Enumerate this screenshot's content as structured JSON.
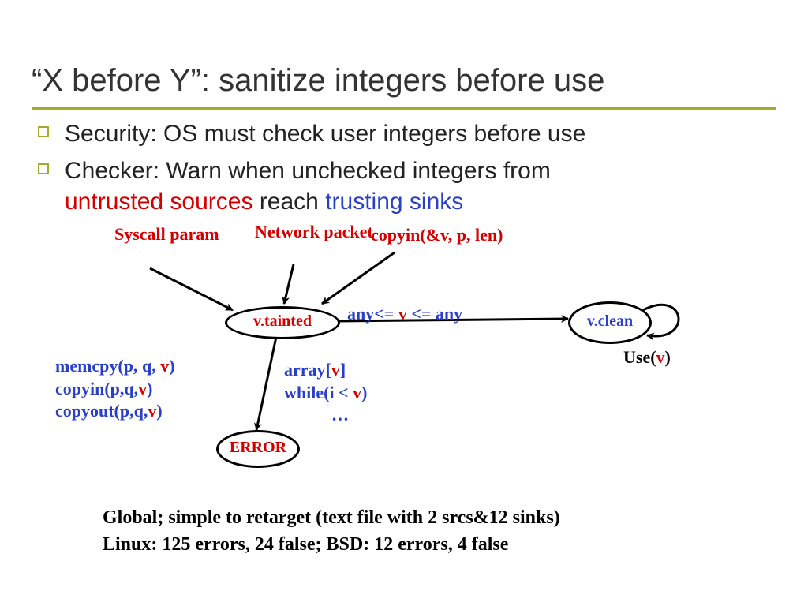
{
  "title": "“X before Y”: sanitize integers before use",
  "bullets": {
    "b1": "Security: OS must check user integers before use",
    "b2_pre": "Checker:  Warn when unchecked integers from ",
    "b2_red": "untrusted sources",
    "b2_mid": " reach ",
    "b2_blue": "trusting sinks"
  },
  "diagram": {
    "syscall": "Syscall param",
    "network": "Network packet",
    "copyin_top": "copyin(&v, p, len)",
    "tainted": "v.tainted",
    "clean": "v.clean",
    "any_left": "any<= ",
    "any_v": "v",
    "any_right": " <= any",
    "use_pre": "Use(",
    "use_v": "v",
    "use_post": ")",
    "memcpy_pre": "memcpy(p, q, ",
    "memcpy_v": "v",
    "memcpy_post": ")",
    "copyin2_pre": "copyin(p,q,",
    "copyin2_v": "v",
    "copyin2_post": ")",
    "copyout_pre": "copyout(p,q,",
    "copyout_v": "v",
    "copyout_post": ")",
    "array_pre": "array[",
    "array_v": "v",
    "array_post": "]",
    "while_pre": "while(i < ",
    "while_v": "v",
    "while_post": ")",
    "ellipsis": "…",
    "error": "ERROR"
  },
  "footnote": {
    "line1": "Global; simple to retarget (text file with 2 srcs&12 sinks)",
    "line2": "Linux: 125 errors, 24 false; BSD: 12 errors, 4 false"
  }
}
